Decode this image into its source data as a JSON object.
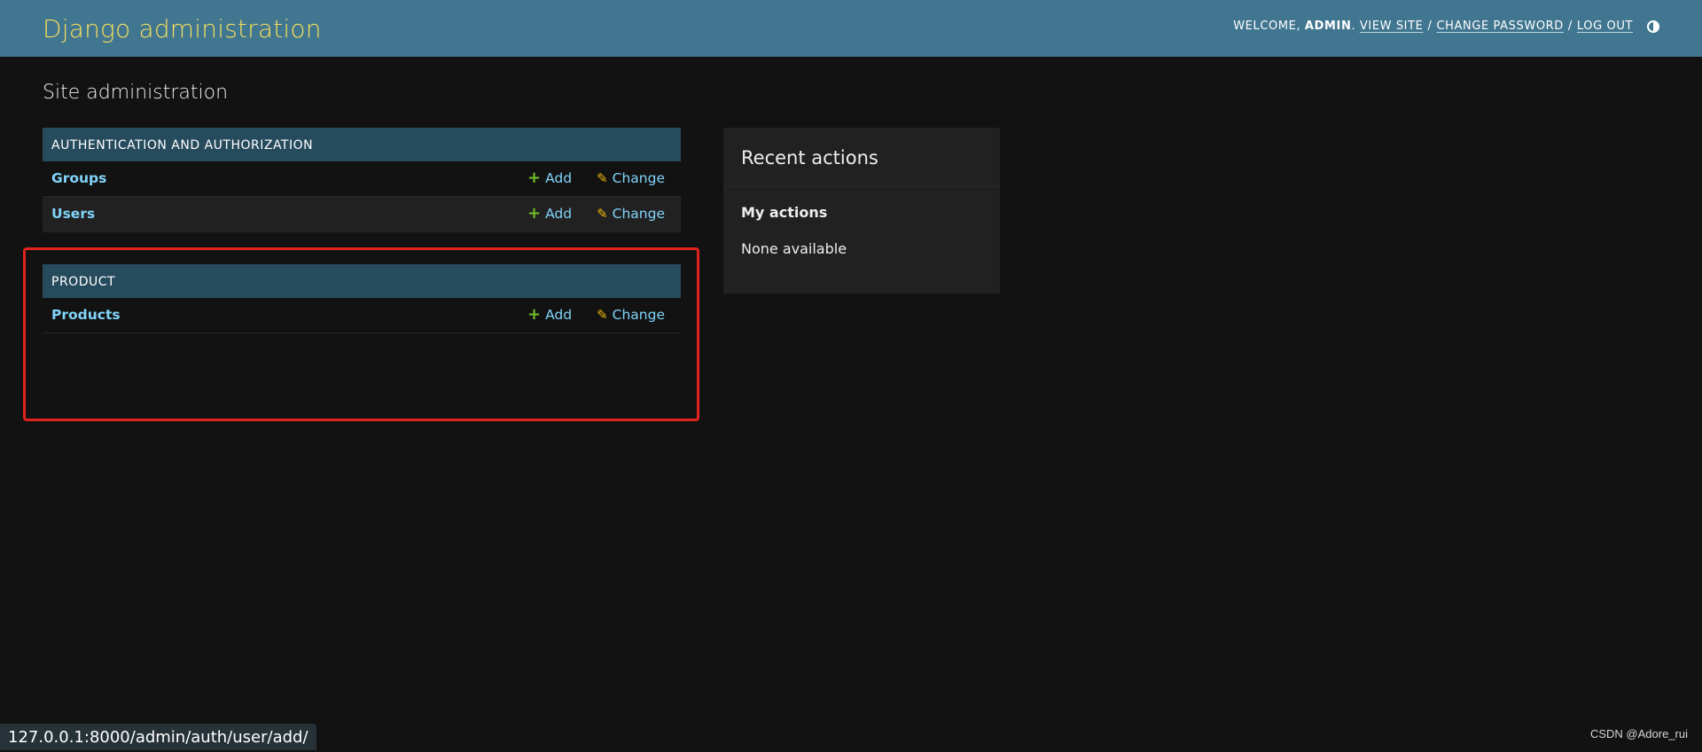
{
  "header": {
    "branding": "Django administration",
    "welcome": "WELCOME,",
    "user": "ADMIN",
    "view_site": "VIEW SITE",
    "change_password": "CHANGE PASSWORD",
    "log_out": "LOG OUT",
    "separator": "/"
  },
  "page": {
    "title": "Site administration"
  },
  "modules": [
    {
      "caption": "AUTHENTICATION AND AUTHORIZATION",
      "models": [
        {
          "name": "Groups",
          "add": "Add",
          "change": "Change"
        },
        {
          "name": "Users",
          "add": "Add",
          "change": "Change"
        }
      ]
    },
    {
      "caption": "PRODUCT",
      "models": [
        {
          "name": "Products",
          "add": "Add",
          "change": "Change"
        }
      ]
    }
  ],
  "recent_actions": {
    "title": "Recent actions",
    "subtitle": "My actions",
    "empty": "None available"
  },
  "status_bar": {
    "url": "127.0.0.1:8000/admin/auth/user/add/"
  },
  "watermark": "CSDN @Adore_rui",
  "icons": {
    "add": "plus-icon",
    "change": "pencil-icon",
    "theme": "contrast-icon"
  },
  "colors": {
    "header_bg": "#417690",
    "branding": "#f5dd5d",
    "caption_bg": "#264b5d",
    "link": "#81d4fa",
    "add_icon": "#70bf2b",
    "change_icon": "#efb80b",
    "highlight": "#e0231f"
  }
}
